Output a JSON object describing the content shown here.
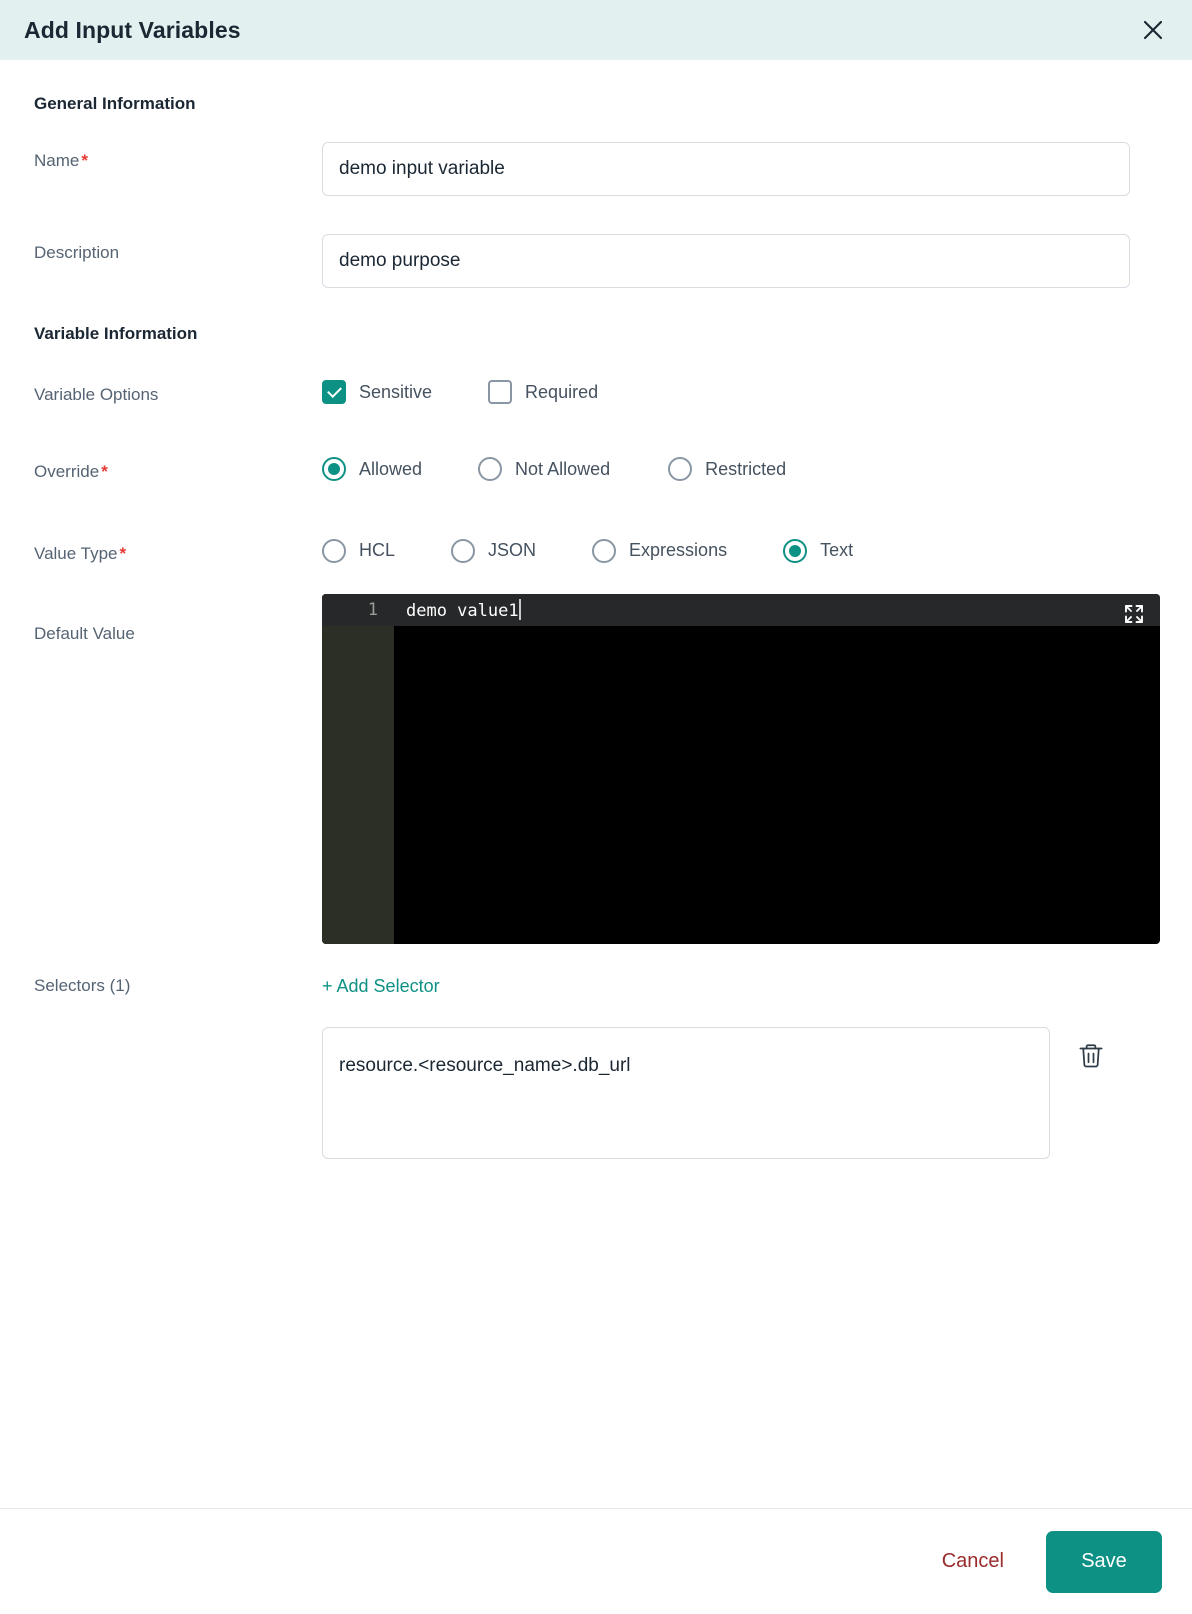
{
  "dialog": {
    "title": "Add Input Variables",
    "close_icon": "close-icon"
  },
  "sections": {
    "general": "General Information",
    "variable": "Variable Information"
  },
  "fields": {
    "name": {
      "label": "Name",
      "required_mark": "*",
      "value": "demo input variable",
      "placeholder": ""
    },
    "description": {
      "label": "Description",
      "value": "demo purpose",
      "placeholder": ""
    },
    "variable_options": {
      "label": "Variable Options",
      "options": [
        {
          "label": "Sensitive",
          "checked": true
        },
        {
          "label": "Required",
          "checked": false
        }
      ]
    },
    "override": {
      "label": "Override",
      "required_mark": "*",
      "options": [
        {
          "label": "Allowed",
          "selected": true
        },
        {
          "label": "Not Allowed",
          "selected": false
        },
        {
          "label": "Restricted",
          "selected": false
        }
      ]
    },
    "value_type": {
      "label": "Value Type",
      "required_mark": "*",
      "options": [
        {
          "label": "HCL",
          "selected": false
        },
        {
          "label": "JSON",
          "selected": false
        },
        {
          "label": "Expressions",
          "selected": false
        },
        {
          "label": "Text",
          "selected": true
        }
      ]
    },
    "default_value": {
      "label": "Default Value",
      "line_number": "1",
      "code": "demo value1",
      "expand_icon": "expand-icon"
    },
    "selectors": {
      "label": "Selectors (1)",
      "add_link": "+ Add Selector",
      "items": [
        {
          "value": "resource.<resource_name>.db_url",
          "delete_icon": "trash-icon"
        }
      ]
    }
  },
  "footer": {
    "cancel_label": "Cancel",
    "save_label": "Save"
  },
  "colors": {
    "accent_teal": "#0d9184",
    "header_band": "#e2f1ef",
    "required_red": "#e53935",
    "cancel_red": "#9a2b2b",
    "editor_bg": "#000000",
    "editor_gutter": "#2b2f26"
  }
}
